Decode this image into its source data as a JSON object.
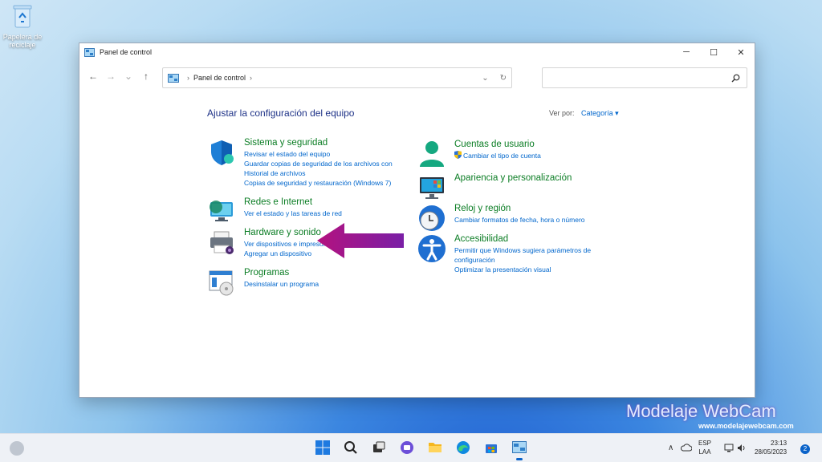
{
  "desktop": {
    "recycle_bin_label": "Papelera de reciclaje"
  },
  "window": {
    "title": "Panel de control",
    "controls": {
      "minimize": "─",
      "maximize": "☐",
      "close": "✕"
    }
  },
  "navigation": {
    "back": "←",
    "forward": "→",
    "recent": "⌄",
    "up": "↑",
    "breadcrumb": [
      "Panel de control"
    ],
    "refresh": "↻",
    "search_placeholder": ""
  },
  "content": {
    "heading": "Ajustar la configuración del equipo",
    "view_by_label": "Ver por:",
    "view_by_value": "Categoría ▾",
    "left_categories": [
      {
        "title": "Sistema y seguridad",
        "links": [
          "Revisar el estado del equipo",
          "Guardar copias de seguridad de los archivos con",
          "Historial de archivos",
          "Copias de seguridad y restauración (Windows 7)"
        ],
        "icon": "shield-icon"
      },
      {
        "title": "Redes e Internet",
        "links": [
          "Ver el estado y las tareas de red"
        ],
        "icon": "network-globe-icon"
      },
      {
        "title": "Hardware y sonido",
        "links": [
          "Ver dispositivos e impresoras",
          "Agregar un dispositivo"
        ],
        "icon": "printer-icon"
      },
      {
        "title": "Programas",
        "links": [
          "Desinstalar un programa"
        ],
        "icon": "programs-icon"
      }
    ],
    "right_categories": [
      {
        "title": "Cuentas de usuario",
        "links": [
          "Cambiar el tipo de cuenta"
        ],
        "icon": "user-icon"
      },
      {
        "title": "Apariencia y personalización",
        "links": [],
        "icon": "monitor-icon"
      },
      {
        "title": "Reloj y región",
        "links": [
          "Cambiar formatos de fecha, hora o número"
        ],
        "icon": "clock-icon"
      },
      {
        "title": "Accesibilidad",
        "links": [
          "Permitir que Windows sugiera parámetros de",
          "configuración",
          "Optimizar la presentación visual"
        ],
        "icon": "accessibility-icon"
      }
    ]
  },
  "watermark": {
    "brand": "Modelaje WebCam",
    "url": "www.modelajewebcam.com"
  },
  "taskbar": {
    "language": "ESP",
    "layout": "LAA",
    "time": "23:13",
    "date": "28/05/2023",
    "notifications": "2",
    "tray_chevron": "∧"
  },
  "colors": {
    "category_title": "#0b7d24",
    "link": "#0066cc",
    "heading": "#1e3287",
    "accent": "#0b63c9"
  }
}
